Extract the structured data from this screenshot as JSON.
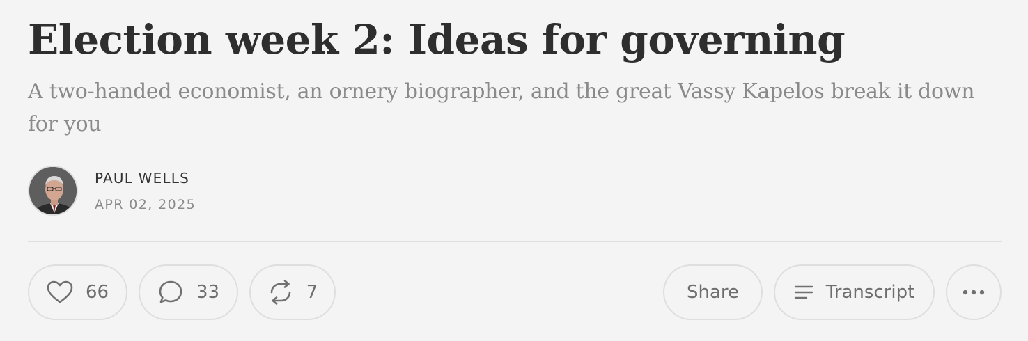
{
  "post": {
    "title": "Election week 2: Ideas for governing",
    "subtitle": "A two-handed economist, an ornery biographer, and the great Vassy Kapelos break it down for you",
    "author": "PAUL WELLS",
    "date": "APR 02, 2025"
  },
  "actions": {
    "like_count": "66",
    "comment_count": "33",
    "restack_count": "7",
    "share_label": "Share",
    "transcript_label": "Transcript"
  },
  "icons": {
    "like": "heart-icon",
    "comment": "comment-bubble-icon",
    "restack": "restack-arrows-icon",
    "transcript": "lines-icon",
    "more": "ellipsis-icon"
  },
  "colors": {
    "background": "#f4f4f4",
    "title": "#2e2e2e",
    "muted": "#8a8a8a",
    "border": "#dedede"
  }
}
